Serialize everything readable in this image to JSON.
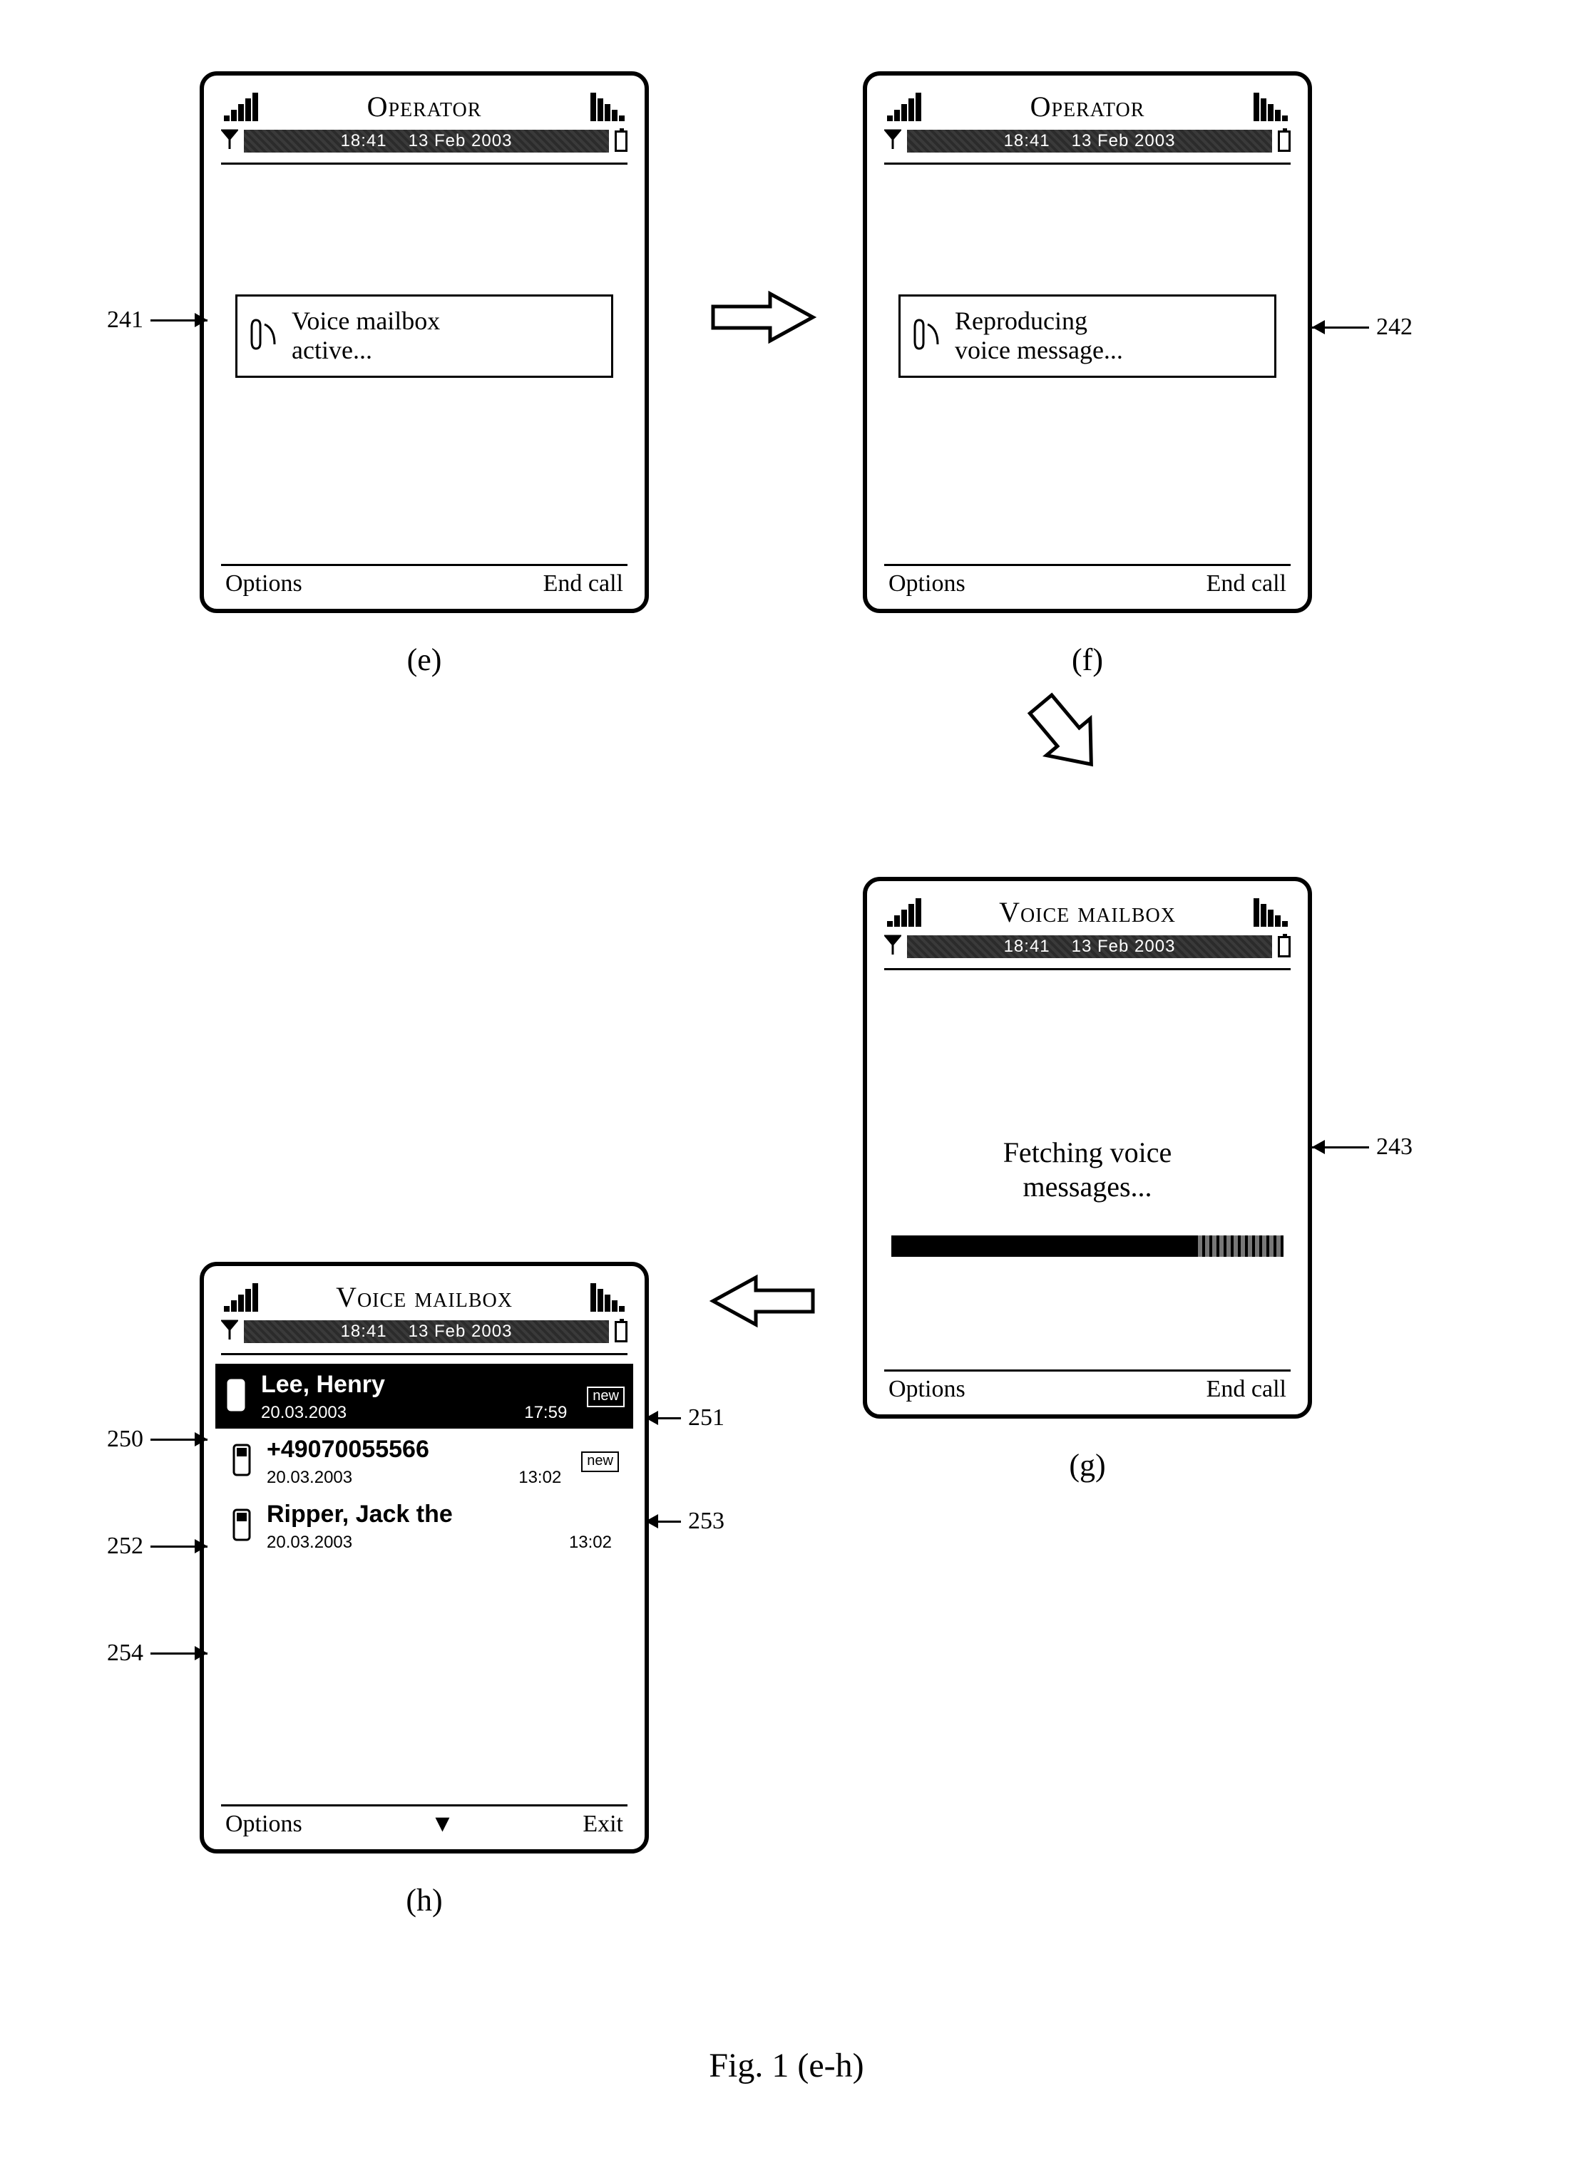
{
  "statusbar": {
    "time": "18:41",
    "date": "13 Feb 2003"
  },
  "e": {
    "title": "Operator",
    "message_line1": "Voice mailbox",
    "message_line2": "active...",
    "left_soft": "Options",
    "right_soft": "End call",
    "label": "(e)",
    "callout": "241"
  },
  "f": {
    "title": "Operator",
    "message_line1": "Reproducing",
    "message_line2": "voice message...",
    "left_soft": "Options",
    "right_soft": "End call",
    "label": "(f)",
    "callout": "242"
  },
  "g": {
    "title": "Voice mailbox",
    "message_line1": "Fetching voice",
    "message_line2": "messages...",
    "left_soft": "Options",
    "right_soft": "End call",
    "label": "(g)",
    "callout": "243"
  },
  "h": {
    "title": "Voice mailbox",
    "rows": [
      {
        "name": "Lee, Henry",
        "date": "20.03.2003",
        "time": "17:59",
        "badge": "new"
      },
      {
        "name": "+49070055566",
        "date": "20.03.2003",
        "time": "13:02",
        "badge": "new"
      },
      {
        "name": "Ripper, Jack the",
        "date": "20.03.2003",
        "time": "13:02",
        "badge": ""
      }
    ],
    "left_soft": "Options",
    "mid_soft": "▼",
    "right_soft": "Exit",
    "label": "(h)",
    "callouts": {
      "row0": "250",
      "badge0": "251",
      "row1": "252",
      "badge1": "253",
      "row2": "254"
    }
  },
  "figure_caption": "Fig. 1 (e-h)"
}
